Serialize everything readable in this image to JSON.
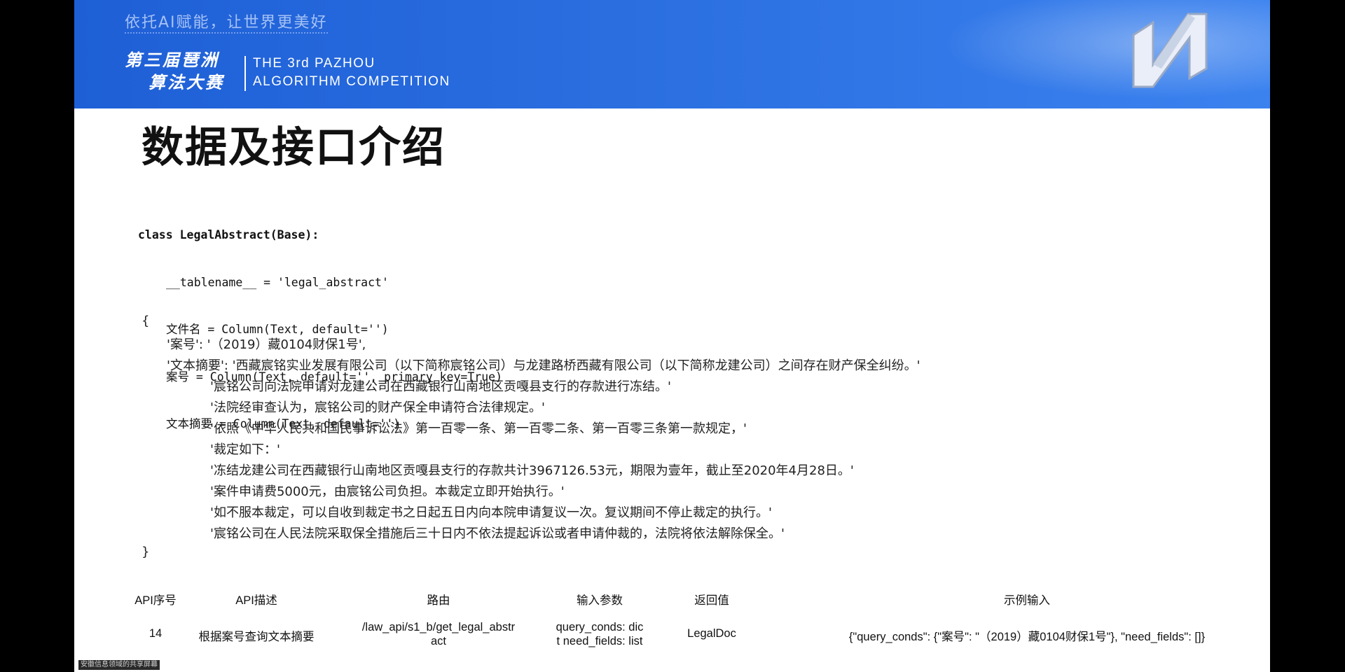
{
  "banner": {
    "slogan": "依托AI赋能，让世界更美好",
    "competition_cn_line1": "第三届琶洲",
    "competition_cn_line2": "算法大赛",
    "competition_en_line1": "THE 3rd PAZHOU",
    "competition_en_line2": "ALGORITHM COMPETITION",
    "accent_color": "#2a6ee0"
  },
  "title": "数据及接口介绍",
  "code": {
    "l1": "class LegalAbstract(Base):",
    "l2": "__tablename__ = 'legal_abstract'",
    "l3": "文件名 = Column(Text, default='')",
    "l4": "案号 = Column(Text, default='', primary_key=True)",
    "l5": "文本摘要 = Column(Text, default='')"
  },
  "json_example": {
    "open": "{",
    "case_line": "'案号': '（2019）藏0104财保1号',",
    "abstract_line": "'文本摘要': '西藏宸铭实业发展有限公司（以下简称宸铭公司）与龙建路桥西藏有限公司（以下简称龙建公司）之间存在财产保全纠纷。'",
    "lines": [
      "'宸铭公司向法院申请对龙建公司在西藏银行山南地区贡嘎县支行的存款进行冻结。'",
      "'法院经审查认为，宸铭公司的财产保全申请符合法律规定。'",
      "'依照《中华人民共和国民事诉讼法》第一百零一条、第一百零二条、第一百零三条第一款规定，'",
      "'裁定如下：'",
      "'冻结龙建公司在西藏银行山南地区贡嘎县支行的存款共计3967126.53元，期限为壹年，截止至2020年4月28日。'",
      "'案件申请费5000元，由宸铭公司负担。本裁定立即开始执行。'",
      "'如不服本裁定，可以自收到裁定书之日起五日内向本院申请复议一次。复议期间不停止裁定的执行。'",
      "'宸铭公司在人民法院采取保全措施后三十日内不依法提起诉讼或者申请仲裁的，法院将依法解除保全。'"
    ],
    "close": "}"
  },
  "api_table": {
    "headers": [
      "API序号",
      "API描述",
      "路由",
      "输入参数",
      "返回值",
      "示例输入"
    ],
    "row": {
      "id": "14",
      "desc": "根据案号查询文本摘要",
      "route_line1": "/law_api/s1_b/get_legal_abstr",
      "route_line2": "act",
      "params_line1": "query_conds: dic",
      "params_line2": "t need_fields: list",
      "returns": "LegalDoc",
      "example": "{\"query_conds\": {\"案号\": \"（2019）藏0104财保1号\"}, \"need_fields\": []}"
    }
  },
  "status_strip": "安徽信息领域的共享屏幕"
}
